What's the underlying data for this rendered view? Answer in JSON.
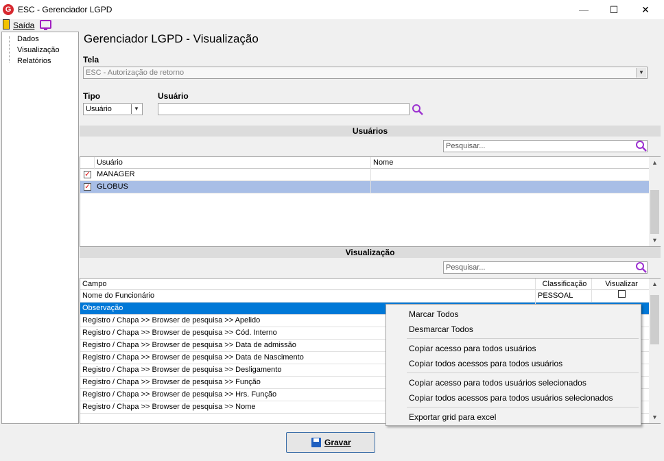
{
  "window": {
    "title": "ESC - Gerenciador LGPD",
    "app_icon": "G",
    "minimize": "—",
    "maximize": "☐",
    "close": "✕"
  },
  "menubar": {
    "exit_label": "Saída"
  },
  "tree": {
    "items": [
      "Dados",
      "Visualização",
      "Relatórios"
    ]
  },
  "main": {
    "title": "Gerenciador LGPD - Visualização",
    "tela_label": "Tela",
    "tela_value": "ESC - Autorização de retorno",
    "tipo_label": "Tipo",
    "tipo_value": "Usuário",
    "usuario_label": "Usuário",
    "usuario_value": ""
  },
  "users_section": {
    "header": "Usuários",
    "search_placeholder": "Pesquisar...",
    "columns": [
      "Usuário",
      "Nome"
    ],
    "rows": [
      {
        "checked": "✓",
        "user": "MANAGER",
        "name": ""
      },
      {
        "checked": "✓",
        "user": "GLOBUS",
        "name": ""
      }
    ]
  },
  "visual_section": {
    "header": "Visualização",
    "search_placeholder": "Pesquisar...",
    "columns": [
      "Campo",
      "Classificação",
      "Visualizar"
    ],
    "rows": [
      {
        "campo": "Nome do Funcionário",
        "classificacao": "PESSOAL"
      },
      {
        "campo": "Observação",
        "classificacao": ""
      },
      {
        "campo": "Registro / Chapa >> Browser de pesquisa >> Apelido",
        "classificacao": ""
      },
      {
        "campo": "Registro / Chapa >> Browser de pesquisa >> Cód. Interno",
        "classificacao": ""
      },
      {
        "campo": "Registro / Chapa >> Browser de pesquisa >> Data de admissão",
        "classificacao": ""
      },
      {
        "campo": "Registro / Chapa >> Browser de pesquisa >> Data de Nascimento",
        "classificacao": ""
      },
      {
        "campo": "Registro / Chapa >> Browser de pesquisa >> Desligamento",
        "classificacao": ""
      },
      {
        "campo": "Registro / Chapa >> Browser de pesquisa >> Função",
        "classificacao": ""
      },
      {
        "campo": "Registro / Chapa >> Browser de pesquisa >> Hrs. Função",
        "classificacao": ""
      },
      {
        "campo": "Registro / Chapa >> Browser de pesquisa >> Nome",
        "classificacao": ""
      }
    ]
  },
  "context_menu": {
    "items": [
      "Marcar Todos",
      "Desmarcar Todos",
      "Copiar acesso para todos usuários",
      "Copiar todos acessos para todos usuários",
      "Copiar acesso para todos usuários selecionados",
      "Copiar todos acessos para todos usuários selecionados",
      "Exportar grid para excel"
    ]
  },
  "footer": {
    "save_label": "Gravar"
  },
  "colors": {
    "selected_row": "#a8bee6",
    "highlight_row": "#0078d7",
    "search_icon": "#9b30d0"
  }
}
